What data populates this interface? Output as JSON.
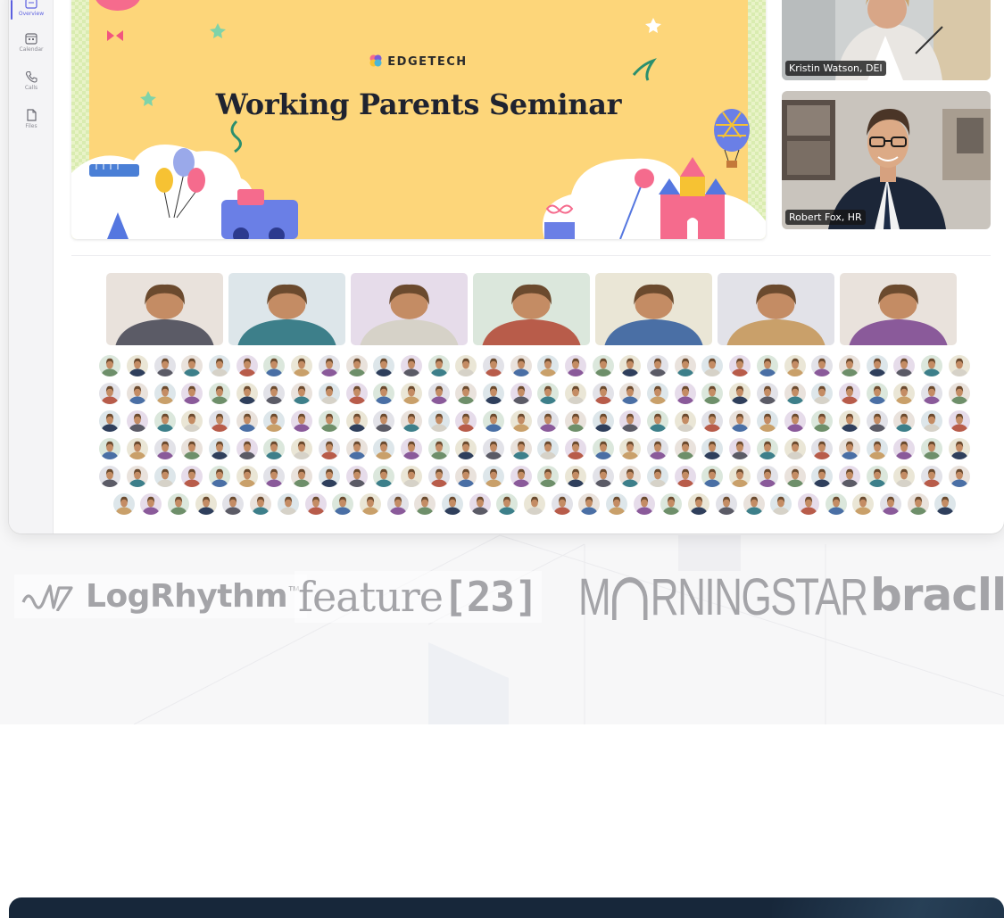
{
  "sidebar": {
    "items": [
      {
        "label": "Overview",
        "icon": "overview-icon",
        "active": true
      },
      {
        "label": "Calendar",
        "icon": "calendar-icon",
        "active": false
      },
      {
        "label": "Calls",
        "icon": "phone-icon",
        "active": false
      },
      {
        "label": "Files",
        "icon": "file-icon",
        "active": false
      }
    ]
  },
  "stage": {
    "brand": "EDGETECH",
    "title": "Working Parents Seminar"
  },
  "speakers": [
    {
      "name": "Kristin Watson, DEI"
    },
    {
      "name": "Robert Fox, HR"
    }
  ],
  "video_tiles_count": 7,
  "audience": {
    "rows": [
      32,
      32,
      32,
      32,
      32,
      31
    ]
  },
  "logos": [
    {
      "name": "LogRhythm",
      "mark": "™"
    },
    {
      "name": "feature",
      "suffix": "[23]"
    },
    {
      "name_start": "M",
      "name_end": "RNINGSTAR"
    },
    {
      "name": "brac",
      "suffix": "ll"
    }
  ],
  "colors": {
    "accent": "#5b5fe0",
    "slide_bg": "#fdd67a",
    "banner_bg": "#17273a",
    "logo_gray": "#a4a4a8"
  }
}
